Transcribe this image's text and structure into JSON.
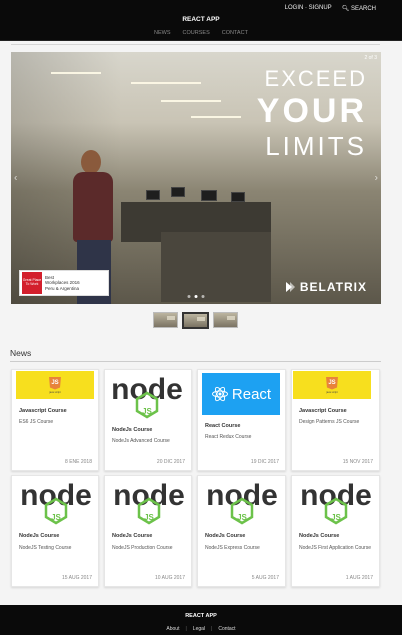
{
  "header": {
    "brand": "REACT APP",
    "login_signup": "LOGIN · SIGNUP",
    "search_label": "SEARCH",
    "nav": [
      "NEWS",
      "COURSES",
      "CONTACT"
    ]
  },
  "carousel": {
    "counter": "2 of 3",
    "headline": [
      "EXCEED",
      "YOUR",
      "LIMITS"
    ],
    "brand_logo": "BELATRIX",
    "badge_text": [
      "Best",
      "Workplaces 2016",
      "Peru & Argentina"
    ],
    "badge_logo_text": "Great Place To Work",
    "active_slide": 2,
    "slide_count": 3
  },
  "thumbnails": {
    "count": 3,
    "active": 2
  },
  "news": {
    "heading": "News",
    "cards": [
      {
        "logo": "js",
        "title": "Javascript Course",
        "subtitle": "ES6 JS Course",
        "date": "8 ENE 2018"
      },
      {
        "logo": "node",
        "title": "NodeJs Course",
        "subtitle": "NodeJs Advanced Course",
        "date": "20 DIC 2017"
      },
      {
        "logo": "react",
        "title": "React Course",
        "subtitle": "React Redux Course",
        "date": "19 DIC 2017"
      },
      {
        "logo": "js",
        "title": "Javascript Course",
        "subtitle": "Design Patterns JS Course",
        "date": "15 NOV 2017"
      },
      {
        "logo": "node",
        "title": "NodeJs Course",
        "subtitle": "NodeJS Testing Course",
        "date": "15 AUG 2017"
      },
      {
        "logo": "node",
        "title": "NodeJs Course",
        "subtitle": "NodeJS Production Course",
        "date": "10 AUG 2017"
      },
      {
        "logo": "node",
        "title": "NodeJs Course",
        "subtitle": "NodeJS Express Course",
        "date": "5 AUG 2017"
      },
      {
        "logo": "node",
        "title": "NodeJs Course",
        "subtitle": "NodeJS First Application Course",
        "date": "1 AUG 2017"
      }
    ]
  },
  "logos": {
    "node_text": "node",
    "react_text": "React",
    "js_caption": "java script"
  },
  "footer": {
    "brand": "REACT APP",
    "links": [
      "About",
      "Legal",
      "Contact"
    ]
  },
  "colors": {
    "header_bg": "#0a0a0a",
    "js_yellow": "#f7df1e",
    "react_blue": "#1da1f2",
    "node_green": "#6cc24a"
  }
}
